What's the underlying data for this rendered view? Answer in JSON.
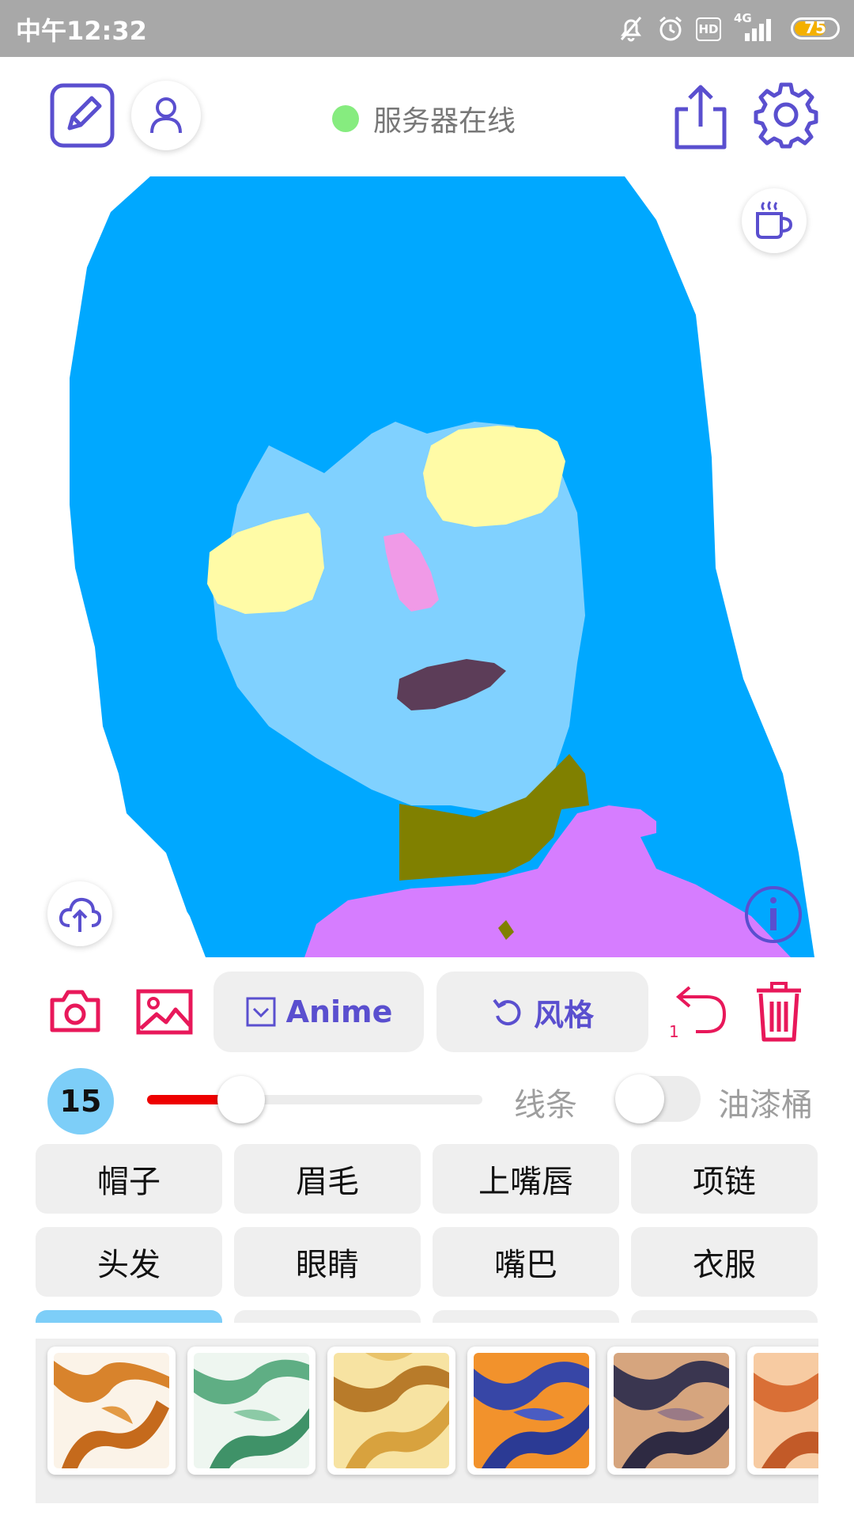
{
  "status_bar": {
    "time": "中午12:32",
    "network": "4G",
    "hd": "HD",
    "battery": "75",
    "battery_fraction": 0.75
  },
  "header": {
    "server_status_text": "服务器在线",
    "server_status_color": "#86ec7f"
  },
  "icons": {
    "edit": "edit-pencil-icon",
    "profile": "user-icon",
    "share": "share-icon",
    "settings": "gear-icon",
    "coffee": "coffee-cup-icon",
    "upload": "cloud-upload-icon",
    "info": "info-icon",
    "camera": "camera-icon",
    "gallery": "image-icon",
    "undo": "undo-icon",
    "delete": "trash-icon"
  },
  "toolbar": {
    "model_label": "Anime",
    "style_label": "风格",
    "undo_count": "1"
  },
  "brush": {
    "size": "15",
    "size_fraction": 0.28,
    "line_label": "线条",
    "bucket_label": "油漆桶",
    "bucket_enabled": false
  },
  "parts": {
    "row1": [
      "帽子",
      "眉毛",
      "上嘴唇",
      "项链"
    ],
    "row2": [
      "头发",
      "眼睛",
      "嘴巴",
      "衣服"
    ]
  },
  "colors": {
    "accent_purple": "#5a4fcf",
    "accent_pink": "#e8185a",
    "slider_red": "#ee0000",
    "size_badge": "#7dcef8",
    "hair": "#00a8ff",
    "face": "#80d1ff",
    "eyes": "#fffba6",
    "nose": "#f09ae7",
    "mouth": "#5c3d58",
    "neck": "#808000",
    "clothes": "#d67dff"
  },
  "style_thumbnails": [
    "orange-white-swirl",
    "green-white-swirl",
    "yellow-brown-swirl",
    "orange-blue-swirl",
    "tan-navy-swirl",
    "peach-orange-swirl"
  ]
}
